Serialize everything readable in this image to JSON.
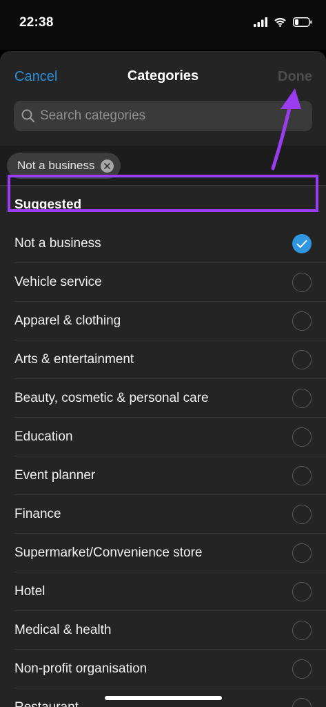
{
  "status_bar": {
    "time": "22:38",
    "icons": [
      "signal-icon",
      "wifi-icon",
      "battery-icon"
    ]
  },
  "nav": {
    "cancel_label": "Cancel",
    "title": "Categories",
    "done_label": "Done"
  },
  "search": {
    "placeholder": "Search categories",
    "value": ""
  },
  "selected_chips": [
    {
      "label": "Not a business"
    }
  ],
  "section": {
    "title": "Suggested"
  },
  "categories": [
    {
      "label": "Not a business",
      "selected": true
    },
    {
      "label": "Vehicle service",
      "selected": false
    },
    {
      "label": "Apparel & clothing",
      "selected": false
    },
    {
      "label": "Arts & entertainment",
      "selected": false
    },
    {
      "label": "Beauty, cosmetic & personal care",
      "selected": false
    },
    {
      "label": "Education",
      "selected": false
    },
    {
      "label": "Event planner",
      "selected": false
    },
    {
      "label": "Finance",
      "selected": false
    },
    {
      "label": "Supermarket/Convenience store",
      "selected": false
    },
    {
      "label": "Hotel",
      "selected": false
    },
    {
      "label": "Medical & health",
      "selected": false
    },
    {
      "label": "Non-profit organisation",
      "selected": false
    },
    {
      "label": "Restaurant",
      "selected": false
    }
  ],
  "colors": {
    "accent": "#2e97e0",
    "link": "#2b8fd6",
    "annotation": "#9a3cf0",
    "sheet_background": "#242424",
    "disabled_text": "#4e4e4e"
  }
}
